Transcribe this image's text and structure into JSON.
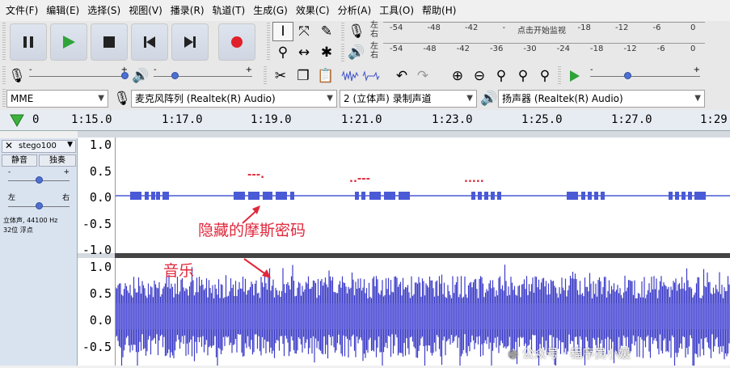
{
  "menu": [
    "文件(F)",
    "编辑(E)",
    "选择(S)",
    "视图(V)",
    "播录(R)",
    "轨道(T)",
    "生成(G)",
    "效果(C)",
    "分析(A)",
    "工具(O)",
    "帮助(H)"
  ],
  "transport": [
    "pause",
    "play",
    "stop",
    "skip-start",
    "skip-end",
    "record"
  ],
  "meter": {
    "record_lr": [
      "左",
      "右"
    ],
    "play_lr": [
      "左",
      "右"
    ],
    "record_ticks": [
      "-54",
      "-48",
      "-42",
      "-",
      "-4",
      "-18",
      "-12",
      "-6",
      "0"
    ],
    "record_hint": "点击开始监视",
    "play_ticks": [
      "-54",
      "-48",
      "-42",
      "-36",
      "-30",
      "-24",
      "-18",
      "-12",
      "-6",
      "0"
    ]
  },
  "mixer": {
    "rec_min": "-",
    "rec_max": "+",
    "play_min": "-",
    "play_max": "+"
  },
  "device": {
    "host": "MME",
    "mic": "麦克风阵列 (Realtek(R) Audio)",
    "channels": "2 (立体声) 录制声道",
    "speaker": "扬声器 (Realtek(R) Audio)"
  },
  "ruler": [
    "0",
    "1:15.0",
    "1:17.0",
    "1:19.0",
    "1:21.0",
    "1:23.0",
    "1:25.0",
    "1:27.0",
    "1:29."
  ],
  "track": {
    "name": "stego100",
    "mute": "静音",
    "solo": "独奏",
    "gain_min": "-",
    "gain_max": "+",
    "pan_left": "左",
    "pan_right": "右",
    "info": "立体声, 44100 Hz",
    "format": "32位 浮点",
    "ch1_axis": [
      "1.0",
      "0.5",
      "0.0",
      "-0.5",
      "-1.0"
    ],
    "ch2_axis": [
      "1.0",
      "0.5",
      "0.0",
      "-0.5"
    ]
  },
  "annotations": {
    "morse": "隐藏的摩斯密码",
    "music": "音乐",
    "morse_marks": [
      "---.",
      "..---",
      "....."
    ]
  },
  "watermark": "公众号 · 程序员小媛",
  "colors": {
    "wave": "#3c3cc8",
    "morse": "#4a5ad6",
    "annotation": "#e0283c"
  }
}
